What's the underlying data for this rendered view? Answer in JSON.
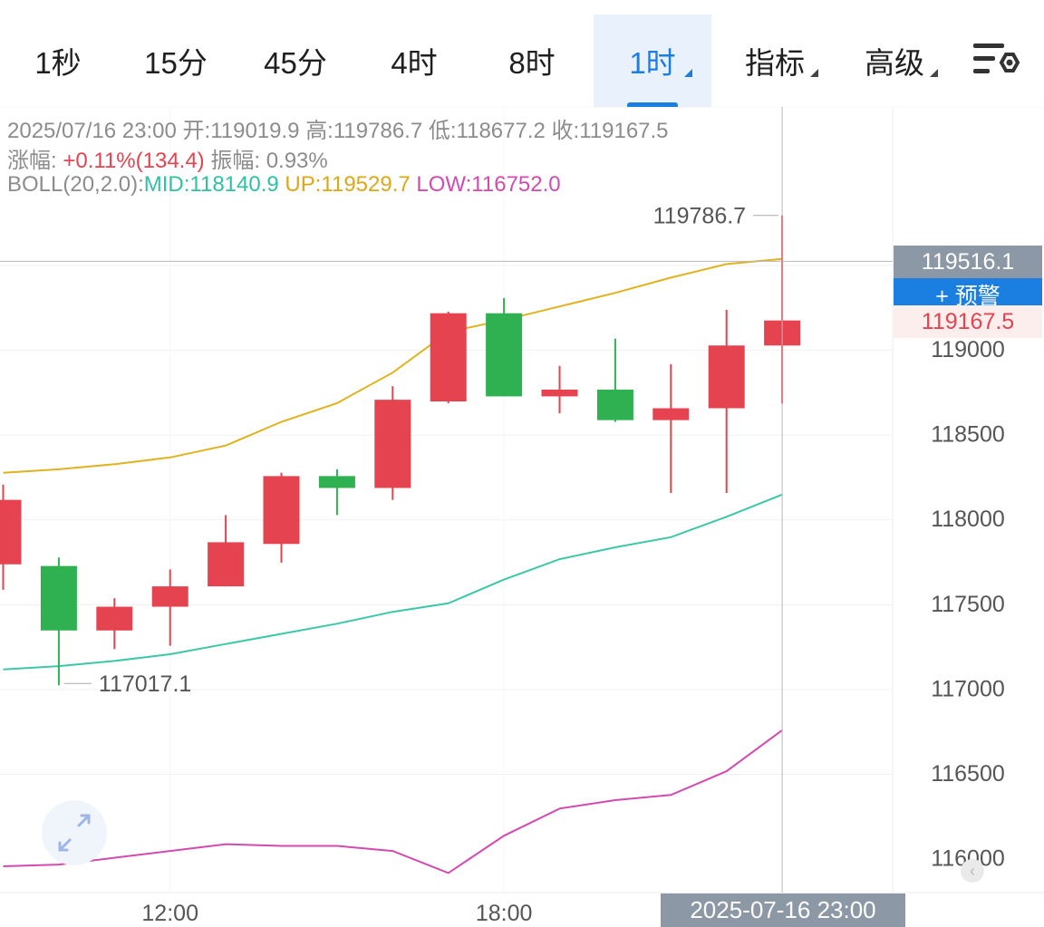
{
  "tabs": [
    {
      "label": "1秒"
    },
    {
      "label": "15分"
    },
    {
      "label": "45分"
    },
    {
      "label": "4时"
    },
    {
      "label": "8时"
    },
    {
      "label": "1时",
      "active": true
    },
    {
      "label": "指标"
    },
    {
      "label": "高级"
    }
  ],
  "info": {
    "date": "2025/07/16 23:00",
    "open_label": "开:",
    "open": "119019.9",
    "high_label": "高:",
    "high": "119786.7",
    "low_label": "低:",
    "low": "118677.2",
    "close_label": "收:",
    "close": "119167.5",
    "change_label": "涨幅:",
    "change": "+0.11%(134.4)",
    "amp_label": "振幅:",
    "amp": "0.93%",
    "boll_label": "BOLL(20,2.0):",
    "mid": "MID:118140.9",
    "up": "UP:119529.7",
    "low_band": "LOW:116752.0"
  },
  "markers": {
    "max_label": "119786.7",
    "min_label": "117017.1"
  },
  "price_tags": {
    "crosshair_price": "119516.1",
    "alert_button": "+ 预警",
    "last_price": "119167.5"
  },
  "time_badge": "2025-07-16 23:00",
  "colors": {
    "up": "#e5434f",
    "down": "#2fb151",
    "mid": "#3cc7a8",
    "upper": "#e0b21e",
    "lower": "#d34ab0",
    "accent": "#1a7fe0"
  },
  "icons": [
    "settings-icon",
    "expand-icon",
    "scroll-left-icon"
  ],
  "chart_data": {
    "type": "candlestick",
    "ylim": [
      115800,
      120000
    ],
    "yticks": [
      119000,
      118500,
      118000,
      117500,
      117000,
      116500,
      116000
    ],
    "xticks": [
      "12:00",
      "18:00"
    ],
    "candles": [
      {
        "open": 117730,
        "high": 118200,
        "low": 117580,
        "close": 118110
      },
      {
        "open": 117720,
        "high": 117770,
        "low": 117017.1,
        "close": 117340
      },
      {
        "open": 117340,
        "high": 117530,
        "low": 117230,
        "close": 117480
      },
      {
        "open": 117480,
        "high": 117700,
        "low": 117250,
        "close": 117600
      },
      {
        "open": 117600,
        "high": 118020,
        "low": 117600,
        "close": 117860
      },
      {
        "open": 117850,
        "high": 118270,
        "low": 117740,
        "close": 118250
      },
      {
        "open": 118250,
        "high": 118290,
        "low": 118020,
        "close": 118180
      },
      {
        "open": 118180,
        "high": 118780,
        "low": 118110,
        "close": 118700
      },
      {
        "open": 118690,
        "high": 119220,
        "low": 118680,
        "close": 119210
      },
      {
        "open": 119210,
        "high": 119300,
        "low": 118720,
        "close": 118720
      },
      {
        "open": 118720,
        "high": 118900,
        "low": 118620,
        "close": 118760
      },
      {
        "open": 118760,
        "high": 119060,
        "low": 118570,
        "close": 118580
      },
      {
        "open": 118580,
        "high": 118910,
        "low": 118150,
        "close": 118650
      },
      {
        "open": 118650,
        "high": 119230,
        "low": 118150,
        "close": 119020
      },
      {
        "open": 119019.9,
        "high": 119786.7,
        "low": 118677.2,
        "close": 119167.5
      }
    ],
    "series": [
      {
        "name": "MID",
        "values": [
          117110,
          117130,
          117160,
          117200,
          117260,
          117320,
          117380,
          117450,
          117500,
          117640,
          117760,
          117830,
          117890,
          118010,
          118140.9
        ]
      },
      {
        "name": "UP",
        "values": [
          118270,
          118290,
          118320,
          118360,
          118430,
          118570,
          118680,
          118860,
          119100,
          119170,
          119250,
          119330,
          119420,
          119500,
          119529.7
        ]
      },
      {
        "name": "LOW",
        "values": [
          115950,
          115960,
          116000,
          116040,
          116080,
          116070,
          116070,
          116040,
          115910,
          116130,
          116290,
          116340,
          116370,
          116510,
          116752.0
        ]
      }
    ],
    "crosshair_price": 119516.1,
    "last_price": 119167.5
  }
}
